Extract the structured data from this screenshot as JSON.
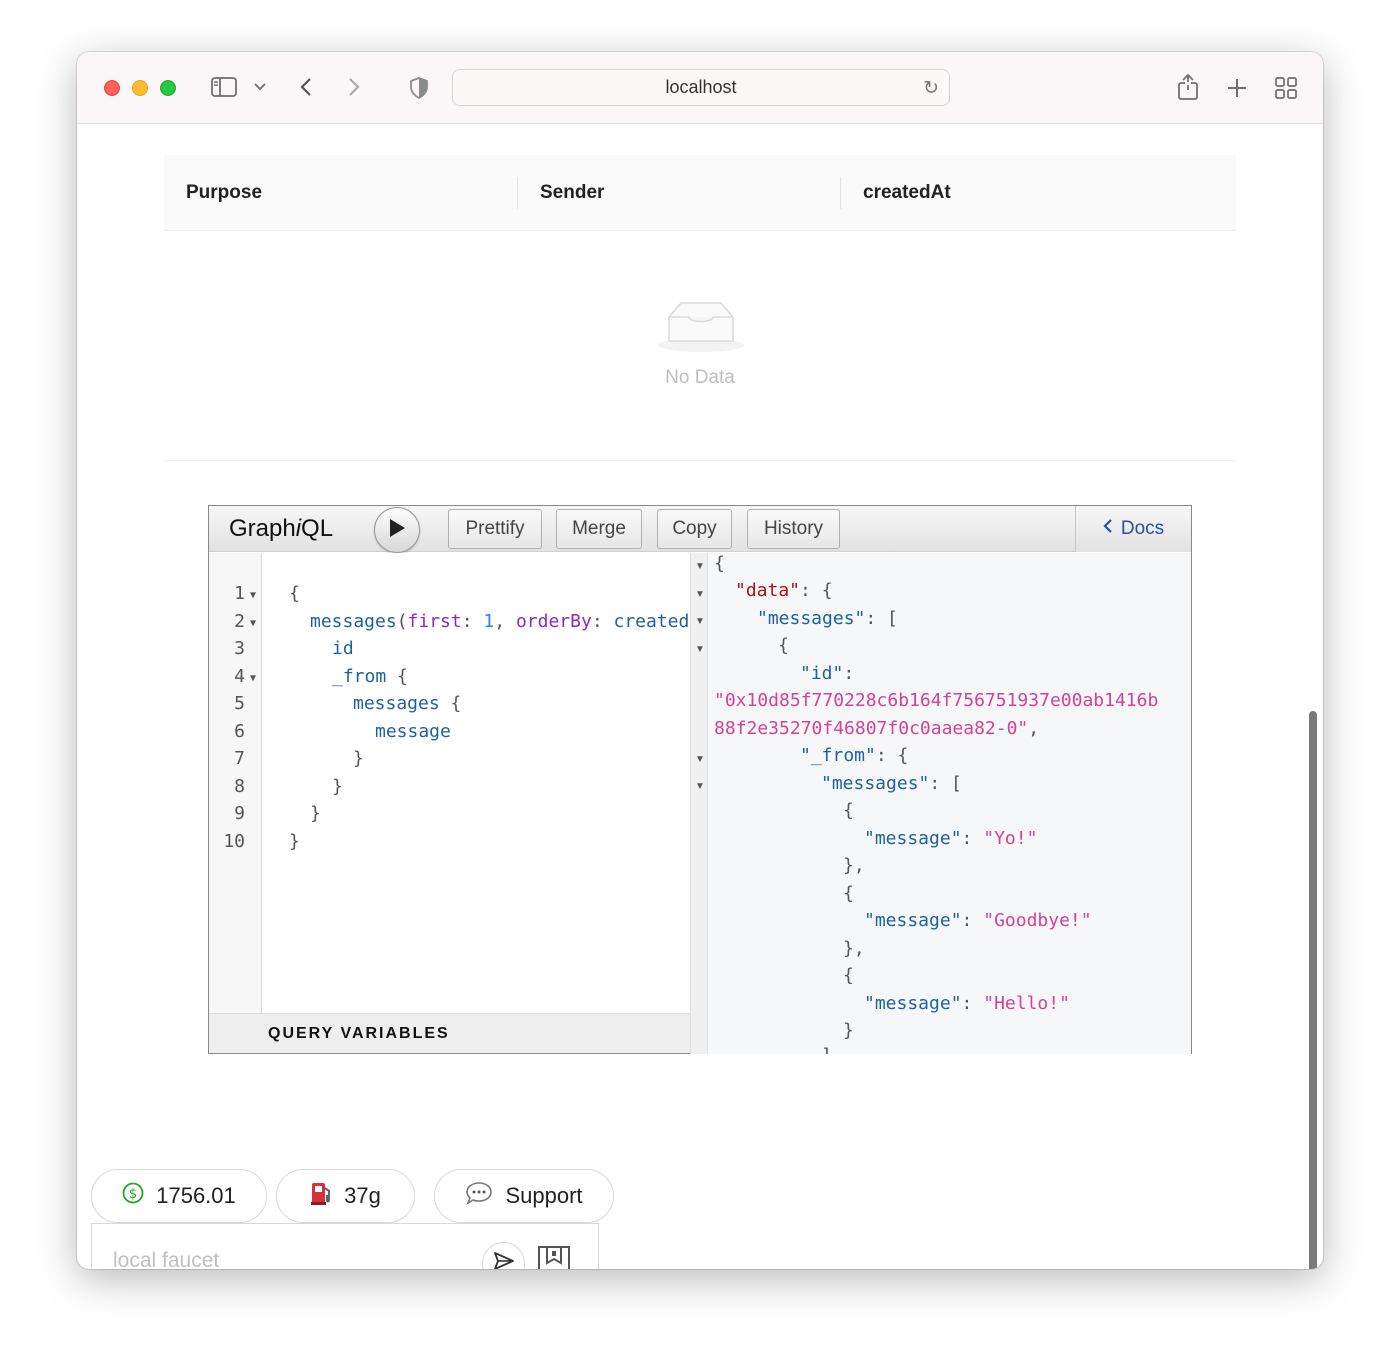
{
  "browser": {
    "url": "localhost"
  },
  "table": {
    "columns": [
      "Purpose",
      "Sender",
      "createdAt"
    ],
    "empty_text": "No Data"
  },
  "graphiql": {
    "title_prefix": "Graph",
    "title_italic": "i",
    "title_suffix": "QL",
    "buttons": [
      "Prettify",
      "Merge",
      "Copy",
      "History"
    ],
    "docs_label": "Docs",
    "query_variables_label": "QUERY VARIABLES",
    "line_numbers": [
      "1",
      "2",
      "3",
      "4",
      "5",
      "6",
      "7",
      "8",
      "9",
      "10"
    ],
    "query": {
      "l1": "{",
      "l2_field": "messages",
      "l2_open": "(",
      "l2_arg1": "first",
      "l2_colon1": ": ",
      "l2_val1": "1",
      "l2_comma": ", ",
      "l2_arg2": "orderBy",
      "l2_colon2": ": ",
      "l2_val2": "createdA",
      "l3": "id",
      "l4_field": "_from",
      "l4_brace": " {",
      "l5_field": "messages",
      "l5_brace": " {",
      "l6": "message",
      "l7": "}",
      "l8": "}",
      "l9": "}",
      "l10": "}"
    },
    "result": {
      "r1": "{",
      "data_key": "\"data\"",
      "data_tail": ": {",
      "messages_key": "\"messages\"",
      "messages_tail": ": [",
      "obj_open": "{",
      "id_key": "\"id\"",
      "id_colon": ":",
      "id_val_1": "\"0x10d85f770228c6b164f756751937e00ab1416b",
      "id_val_2": "88f2e35270f46807f0c0aaea82-0\"",
      "id_comma": ",",
      "from_key": "\"_from\"",
      "from_tail": ": {",
      "inner_messages_key": "\"messages\"",
      "inner_messages_tail": ": [",
      "message_key": "\"message\"",
      "colon": ": ",
      "msg1": "\"Yo!\"",
      "msg2": "\"Goodbye!\"",
      "msg3": "\"Hello!\"",
      "close_obj": "}",
      "close_obj_comma": "},",
      "close_arr": "]"
    }
  },
  "footer": {
    "balance": "1756.01",
    "gas": "37g",
    "support": "Support",
    "faucet_placeholder": "local faucet"
  },
  "icons": {
    "sidebar": "sidebar-icon",
    "back": "chevron-left-icon",
    "forward": "chevron-right-icon",
    "shield": "shield-icon",
    "reload": "reload-icon",
    "share": "share-icon",
    "new_tab": "plus-icon",
    "tabs": "tab-overview-icon",
    "dollar": "dollar-icon",
    "gas": "fuel-pump-icon",
    "support": "speech-bubble-icon",
    "send": "send-icon",
    "wallet": "wallet-icon",
    "sun": "sun-icon"
  },
  "colors": {
    "graphql_key": "#1f61a0",
    "graphql_arg": "#8b2bb9",
    "json_string": "#d64292",
    "docs_link": "#2b4ea0"
  }
}
